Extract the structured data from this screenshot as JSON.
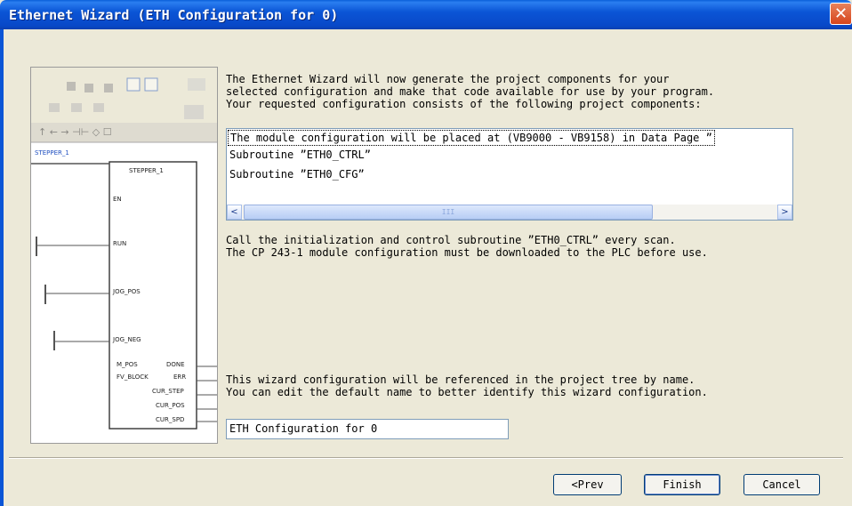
{
  "window": {
    "title": "Ethernet Wizard (ETH Configuration for 0)",
    "close_label": "✕"
  },
  "preview": {
    "labels": [
      "STEPPER_1",
      "EN",
      "RUN",
      "JOG_POS",
      "JOG_NEG",
      "M_POS",
      "FV_BLOCK",
      "DONE",
      "ERR",
      "CUR_STEP",
      "CUR_POS",
      "CUR_SPD"
    ]
  },
  "intro": {
    "line1": "The Ethernet Wizard will now generate the project components for your",
    "line2": "selected configuration and make that code available for use by your program.",
    "line3": "Your requested configuration consists of the following project components:"
  },
  "components": [
    "The module configuration will be placed at (VB9000 - VB9158) in Data Page ”",
    "Subroutine ”ETH0_CTRL”",
    "Subroutine ”ETH0_CFG”"
  ],
  "scroll": {
    "left": "<",
    "right": ">",
    "grip": "III"
  },
  "note": {
    "line1": "Call the initialization and control subroutine ”ETH0_CTRL” every scan.",
    "line2": "The CP 243-1  module configuration must be downloaded to the PLC before use."
  },
  "naming": {
    "line1": "This wizard configuration will be referenced in the project tree by name.",
    "line2": "You can edit the default name to better identify this wizard configuration.",
    "value": "ETH Configuration for 0"
  },
  "buttons": {
    "prev": "<Prev",
    "finish": "Finish",
    "cancel": "Cancel"
  },
  "colors": {
    "titlebar": "#0b55d6",
    "dialog_bg": "#ece9d8",
    "close": "#d6451c"
  }
}
